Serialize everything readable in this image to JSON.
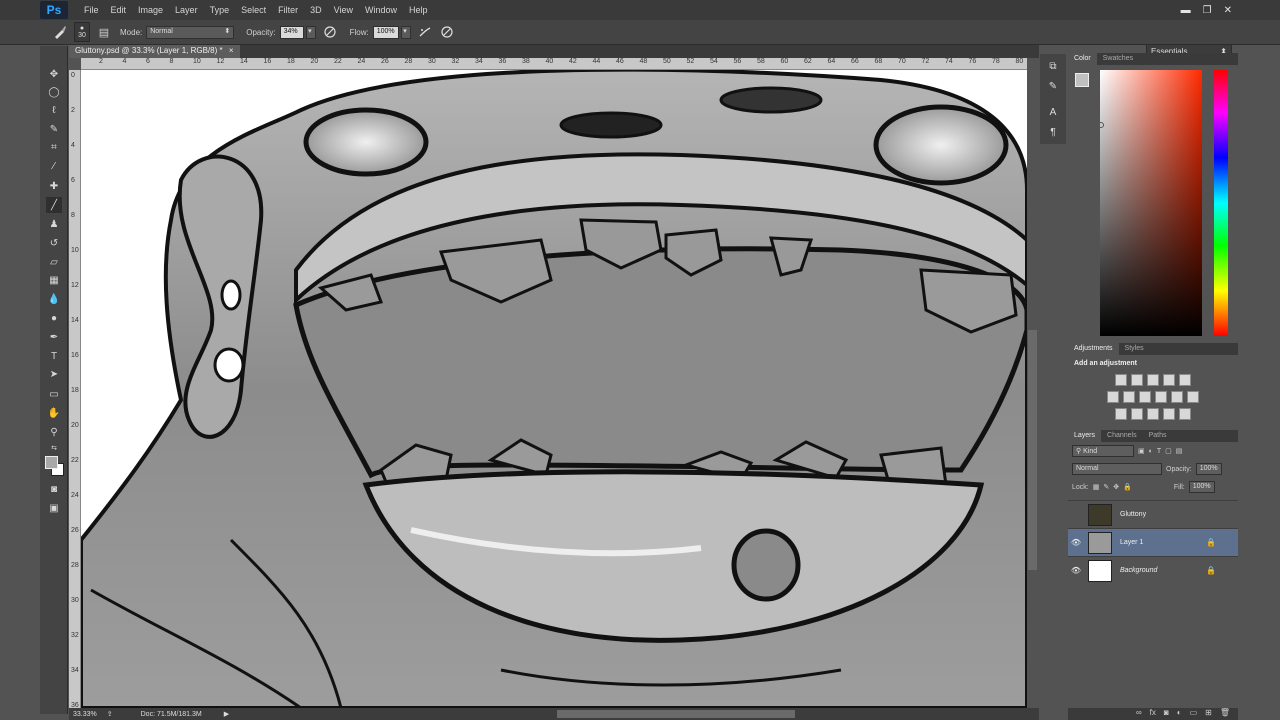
{
  "app": {
    "logo": "Ps"
  },
  "menu": [
    "File",
    "Edit",
    "Image",
    "Layer",
    "Type",
    "Select",
    "Filter",
    "3D",
    "View",
    "Window",
    "Help"
  ],
  "window_controls": {
    "minimize": "▬",
    "restore": "❐",
    "close": "✕"
  },
  "options": {
    "brush_size": "30",
    "mode_label": "Mode:",
    "mode_value": "Normal",
    "opacity_label": "Opacity:",
    "opacity_value": "34%",
    "flow_label": "Flow:",
    "flow_value": "100%",
    "workspace": "Essentials"
  },
  "document": {
    "tab_title": "Gluttony.psd @ 33.3% (Layer 1, RGB/8) *",
    "tab_close": "×"
  },
  "ruler": {
    "h_ticks": [
      "2",
      "4",
      "6",
      "8",
      "10",
      "12",
      "14",
      "16",
      "18",
      "20",
      "22",
      "24",
      "26",
      "28",
      "30",
      "32",
      "34",
      "36",
      "38",
      "40",
      "42",
      "44",
      "46",
      "48",
      "50",
      "52",
      "54",
      "56",
      "58",
      "60",
      "62",
      "64",
      "66",
      "68",
      "70",
      "72",
      "74",
      "76",
      "78",
      "80"
    ],
    "v_ticks": [
      "0",
      "2",
      "4",
      "6",
      "8",
      "10",
      "12",
      "14",
      "16",
      "18",
      "20",
      "22",
      "24",
      "26",
      "28",
      "30",
      "32",
      "34",
      "36"
    ]
  },
  "status": {
    "zoom": "33.33%",
    "doc": "Doc: 71.5M/181.3M"
  },
  "color_panel": {
    "tabs": [
      "Color",
      "Swatches"
    ]
  },
  "adjustments_panel": {
    "tabs": [
      "Adjustments",
      "Styles"
    ],
    "title": "Add an adjustment"
  },
  "layers_panel": {
    "tabs": [
      "Layers",
      "Channels",
      "Paths"
    ],
    "filter_kind": "Kind",
    "blend_mode": "Normal",
    "opacity_label": "Opacity:",
    "opacity_value": "100%",
    "lock_label": "Lock:",
    "fill_label": "Fill:",
    "fill_value": "100%",
    "layers": [
      {
        "name": "Gluttony",
        "visible": false,
        "selected": false
      },
      {
        "name": "Layer 1",
        "visible": true,
        "selected": true
      },
      {
        "name": "Background",
        "visible": true,
        "selected": false
      }
    ]
  },
  "colors": {
    "foreground": "#c0c0c0",
    "background": "#ffffff",
    "selection": "#5d718f",
    "mouth_fill": "#8a8a8a"
  },
  "icons": {
    "tools": [
      "move-icon",
      "marquee-icon",
      "lasso-icon",
      "quick-select-icon",
      "crop-icon",
      "eyedropper-icon",
      "healing-brush-icon",
      "brush-icon",
      "clone-stamp-icon",
      "history-brush-icon",
      "eraser-icon",
      "gradient-icon",
      "blur-icon",
      "dodge-icon",
      "pen-icon",
      "type-icon",
      "path-select-icon",
      "shape-icon",
      "hand-icon",
      "zoom-icon"
    ]
  }
}
